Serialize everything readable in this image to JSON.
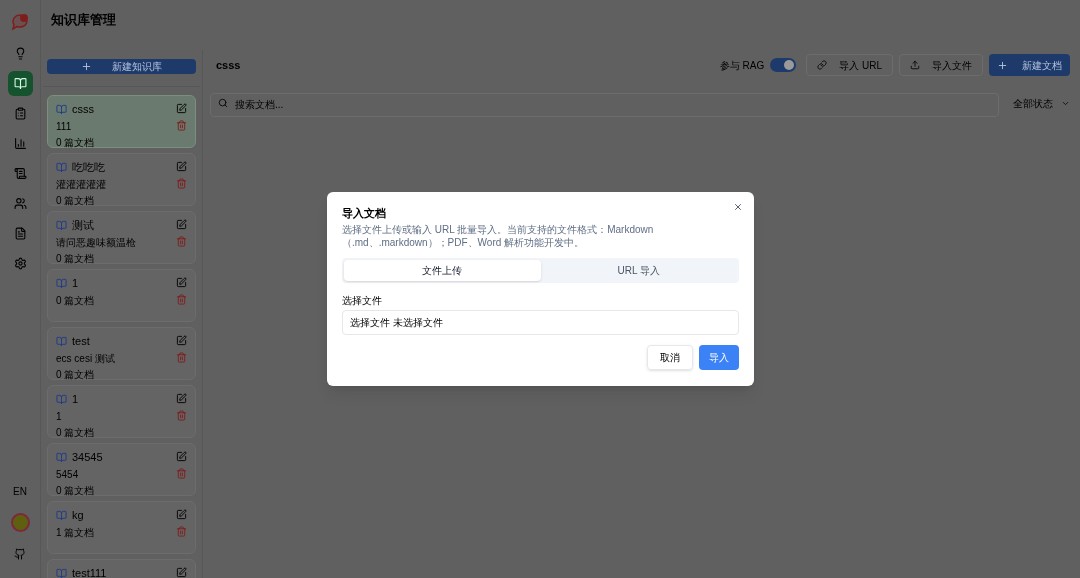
{
  "page_title": "知识库管理",
  "nav": [
    {
      "selected": false
    },
    {
      "selected": true
    },
    {
      "selected": false
    },
    {
      "selected": false
    },
    {
      "selected": false
    },
    {
      "selected": false
    },
    {
      "selected": false
    },
    {
      "selected": false
    }
  ],
  "language_button": "EN",
  "new_kb_button": "新建知识库",
  "knowledge_bases": [
    {
      "name": "csss",
      "description": "111",
      "doc_count": "0 篇文档",
      "selected": true
    },
    {
      "name": "吃吃吃",
      "description": "灌灌灌灌灌",
      "doc_count": "0 篇文档",
      "selected": false
    },
    {
      "name": "测试",
      "description": "请问恶趣味额温枪",
      "doc_count": "0 篇文档",
      "selected": false
    },
    {
      "name": "1",
      "doc_count": "0 篇文档",
      "selected": false
    },
    {
      "name": "test",
      "description": "ecs cesi 测试",
      "doc_count": "0 篇文档",
      "selected": false
    },
    {
      "name": "1",
      "description": "1",
      "doc_count": "0 篇文档",
      "selected": false
    },
    {
      "name": "34545",
      "description": "5454",
      "doc_count": "0 篇文档",
      "selected": false
    },
    {
      "name": "kg",
      "doc_count": "1 篇文档",
      "selected": false
    },
    {
      "name": "test111",
      "selected": false
    }
  ],
  "detail": {
    "title": "csss",
    "rag_label": "参与 RAG",
    "rag_on": true,
    "import_url_button": "导入 URL",
    "import_file_button": "导入文件",
    "new_doc_button": "新建文档",
    "search_placeholder": "搜索文档...",
    "status_filter": "全部状态"
  },
  "dialog": {
    "title": "导入文档",
    "description": "选择文件上传或输入 URL 批量导入。当前支持的文件格式：Markdown（.md、.markdown）；PDF、Word 解析功能开发中。",
    "tabs": [
      {
        "label": "文件上传",
        "selected": true
      },
      {
        "label": "URL 导入",
        "selected": false
      }
    ],
    "file_label": "选择文件",
    "file_button": "选择文件",
    "file_status": "未选择文件",
    "cancel_button": "取消",
    "import_button": "导入"
  }
}
